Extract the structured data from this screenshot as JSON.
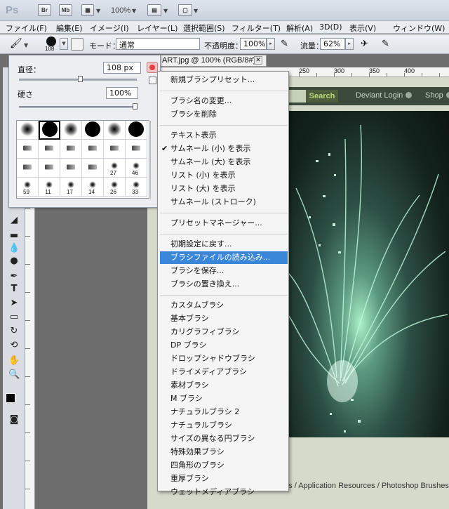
{
  "app": {
    "logo": "Ps",
    "bridge_label": "Br",
    "minibridge_label": "Mb",
    "zoom": "100%"
  },
  "menubar": [
    "ファイル(F)",
    "編集(E)",
    "イメージ(I)",
    "レイヤー(L)",
    "選択範囲(S)",
    "フィルター(T)",
    "解析(A)",
    "3D(D)",
    "表示(V)",
    "ウィンドウ(W)"
  ],
  "options": {
    "brush_size": "108",
    "mode_label": "モード：",
    "mode_value": "通常",
    "opacity_label": "不透明度：",
    "opacity_value": "100%",
    "flow_label": "流量：",
    "flow_value": "62%"
  },
  "document": {
    "tab_title": "ART.jpg @ 100% (RGB/8#)",
    "ruler_numbers": [
      "250",
      "300",
      "350",
      "400"
    ],
    "site": {
      "search_label": "Search",
      "nav": [
        "Deviant Login",
        "Shop"
      ],
      "bottom_links": "Resources & Stock Images  /  Application Resources  /  Photoshop Brushes"
    }
  },
  "brush_panel": {
    "diameter_label": "直径：",
    "diameter_value": "108 px",
    "hardness_label": "硬さ",
    "hardness_value": "100%",
    "presets": [
      {
        "type": "soft"
      },
      {
        "type": "hard"
      },
      {
        "type": "soft"
      },
      {
        "type": "hard"
      },
      {
        "type": "soft"
      },
      {
        "type": "hard"
      },
      {
        "type": "tip"
      },
      {
        "type": "tip"
      },
      {
        "type": "tip"
      },
      {
        "type": "tip"
      },
      {
        "type": "tip"
      },
      {
        "type": "tip"
      },
      {
        "type": "tip"
      },
      {
        "type": "tip"
      },
      {
        "type": "tip"
      },
      {
        "type": "tip"
      },
      {
        "type": "splat",
        "label": "27"
      },
      {
        "type": "splat",
        "label": "46"
      },
      {
        "type": "splat",
        "label": "59"
      },
      {
        "type": "splat",
        "label": "11"
      },
      {
        "type": "splat",
        "label": "17"
      },
      {
        "type": "splat",
        "label": "14"
      },
      {
        "type": "splat",
        "label": "26"
      },
      {
        "type": "splat",
        "label": "33"
      }
    ]
  },
  "context_menu": {
    "items": [
      {
        "label": "新規ブラシプリセット..."
      },
      {
        "sep": true
      },
      {
        "label": "ブラシ名の変更..."
      },
      {
        "label": "ブラシを削除"
      },
      {
        "sep": true
      },
      {
        "label": "テキスト表示"
      },
      {
        "label": "サムネール (小) を表示",
        "checked": true
      },
      {
        "label": "サムネール (大) を表示"
      },
      {
        "label": "リスト (小) を表示"
      },
      {
        "label": "リスト (大) を表示"
      },
      {
        "label": "サムネール (ストローク)"
      },
      {
        "sep": true
      },
      {
        "label": "プリセットマネージャー..."
      },
      {
        "sep": true
      },
      {
        "label": "初期設定に戻す..."
      },
      {
        "label": "ブラシファイルの読み込み...",
        "highlighted": true
      },
      {
        "label": "ブラシを保存..."
      },
      {
        "label": "ブラシの置き換え..."
      },
      {
        "sep": true
      },
      {
        "label": "カスタムブラシ"
      },
      {
        "label": "基本ブラシ"
      },
      {
        "label": "カリグラフィブラシ"
      },
      {
        "label": "DP ブラシ"
      },
      {
        "label": "ドロップシャドウブラシ"
      },
      {
        "label": "ドライメディアブラシ"
      },
      {
        "label": "素材ブラシ"
      },
      {
        "label": "M ブラシ"
      },
      {
        "label": "ナチュラルブラシ 2"
      },
      {
        "label": "ナチュラルブラシ"
      },
      {
        "label": "サイズの異なる円ブラシ"
      },
      {
        "label": "特殊効果ブラシ"
      },
      {
        "label": "四角形のブラシ"
      },
      {
        "label": "重厚ブラシ"
      },
      {
        "label": "ウェットメディアブラシ"
      }
    ]
  }
}
